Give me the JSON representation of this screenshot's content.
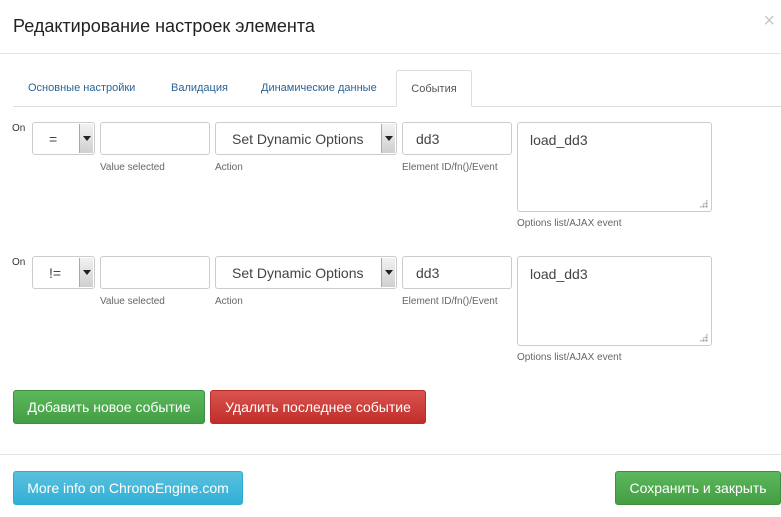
{
  "dialog": {
    "title": "Редактирование настроек элемента",
    "close_glyph": "×"
  },
  "tabs": [
    {
      "label": "Основные настройки"
    },
    {
      "label": "Валидация"
    },
    {
      "label": "Динамические данные"
    },
    {
      "label": "События",
      "active": true
    }
  ],
  "events": [
    {
      "on_label": "On",
      "operator": "=",
      "value": "",
      "value_hint": "Value selected",
      "action": "Set Dynamic Options",
      "action_hint": "Action",
      "element_id": "dd3",
      "element_hint": "Element ID/fn()/Event",
      "options": "load_dd3",
      "options_hint": "Options list/AJAX event"
    },
    {
      "on_label": "On",
      "operator": "!=",
      "value": "",
      "value_hint": "Value selected",
      "action": "Set Dynamic Options",
      "action_hint": "Action",
      "element_id": "dd3",
      "element_hint": "Element ID/fn()/Event",
      "options": "load_dd3",
      "options_hint": "Options list/AJAX event"
    }
  ],
  "buttons": {
    "add_event": "Добавить новое событие",
    "remove_last_event": "Удалить последнее событие",
    "more_info": "More info on ChronoEngine.com",
    "save_close": "Сохранить и закрыть"
  },
  "colors": {
    "green": "#5cb85c",
    "red": "#d9534f",
    "blue": "#5bc0de",
    "tab_link": "#2a6496"
  },
  "icons": {
    "close": "close-icon",
    "select_arrow": "chevron-down-icon",
    "resize": "resize-grip-icon"
  }
}
